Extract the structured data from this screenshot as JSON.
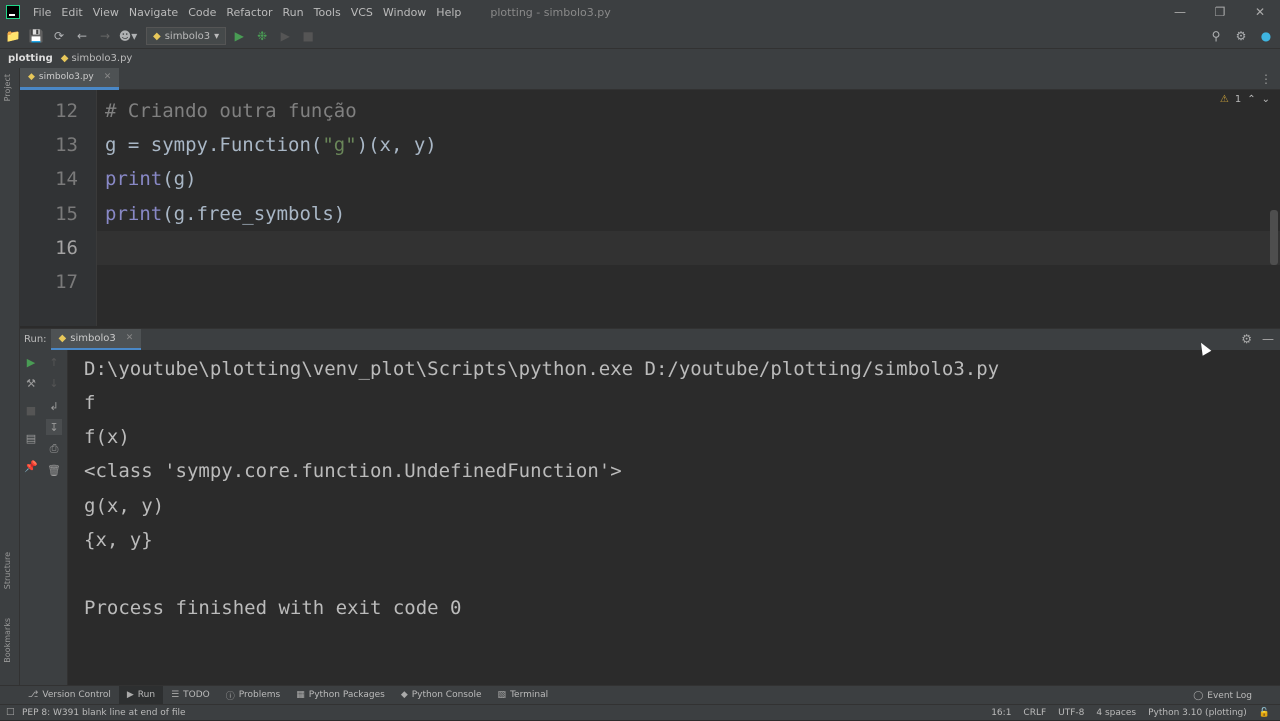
{
  "menubar": {
    "items": [
      "File",
      "Edit",
      "View",
      "Navigate",
      "Code",
      "Refactor",
      "Run",
      "Tools",
      "VCS",
      "Window",
      "Help"
    ],
    "title": "plotting - simbolo3.py"
  },
  "toolbar": {
    "run_config": "simbolo3"
  },
  "breadcrumb": {
    "project": "plotting",
    "file": "simbolo3.py"
  },
  "editor": {
    "tab": "simbolo3.py",
    "inspection_count": "1",
    "line_numbers": [
      "12",
      "13",
      "14",
      "15",
      "16",
      "17"
    ],
    "lines": {
      "l12": "# Criando outra função",
      "l13_a": "g = sympy.Function(",
      "l13_b": "\"g\"",
      "l13_c": ")(x, y)",
      "l14_a": "print",
      "l14_b": "(g)",
      "l15_a": "print",
      "l15_b": "(g.free_symbols)"
    }
  },
  "run": {
    "title": "Run:",
    "tab": "simbolo3",
    "output": [
      "D:\\youtube\\plotting\\venv_plot\\Scripts\\python.exe D:/youtube/plotting/simbolo3.py",
      "f",
      "f(x)",
      "<class 'sympy.core.function.UndefinedFunction'>",
      "g(x, y)",
      "{x, y}",
      "",
      "Process finished with exit code 0"
    ]
  },
  "side_labels": {
    "project": "Project",
    "structure": "Structure",
    "bookmarks": "Bookmarks"
  },
  "bottom_tools": {
    "version_control": "Version Control",
    "run": "Run",
    "todo": "TODO",
    "problems": "Problems",
    "python_packages": "Python Packages",
    "python_console": "Python Console",
    "terminal": "Terminal",
    "event_log": "Event Log"
  },
  "statusbar": {
    "message": "PEP 8: W391 blank line at end of file",
    "position": "16:1",
    "line_sep": "CRLF",
    "encoding": "UTF-8",
    "indent": "4 spaces",
    "interpreter": "Python 3.10 (plotting)"
  }
}
